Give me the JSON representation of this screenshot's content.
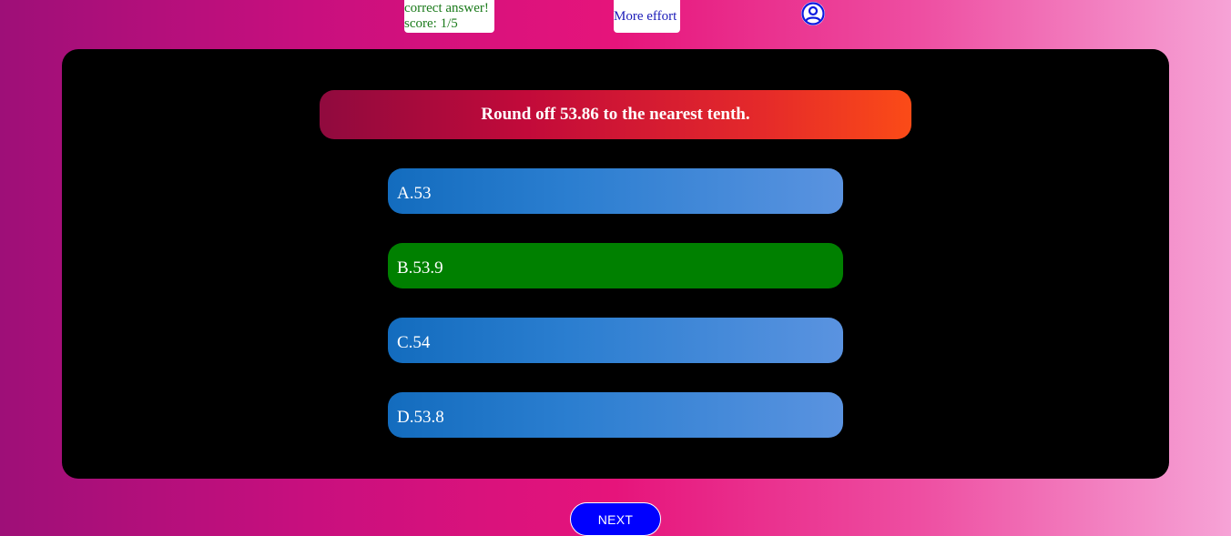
{
  "status": {
    "message": "correct answer!",
    "score": "score: 1/5"
  },
  "feedback": {
    "label": "More effort"
  },
  "profile": {
    "icon": "user-circle-icon"
  },
  "quiz": {
    "question": "Round off 53.86 to the nearest tenth.",
    "options": [
      {
        "label": "A.53",
        "state": "default"
      },
      {
        "label": "B.53.9",
        "state": "correct"
      },
      {
        "label": "C.54",
        "state": "default"
      },
      {
        "label": "D.53.8",
        "state": "default"
      }
    ]
  },
  "navigation": {
    "next_label": "NEXT"
  },
  "colors": {
    "correct": "#008000",
    "option": "#2b7ed0",
    "next_button": "#0000ff",
    "status_text": "#1a7a1a",
    "feedback_text": "#1a1ab8"
  }
}
